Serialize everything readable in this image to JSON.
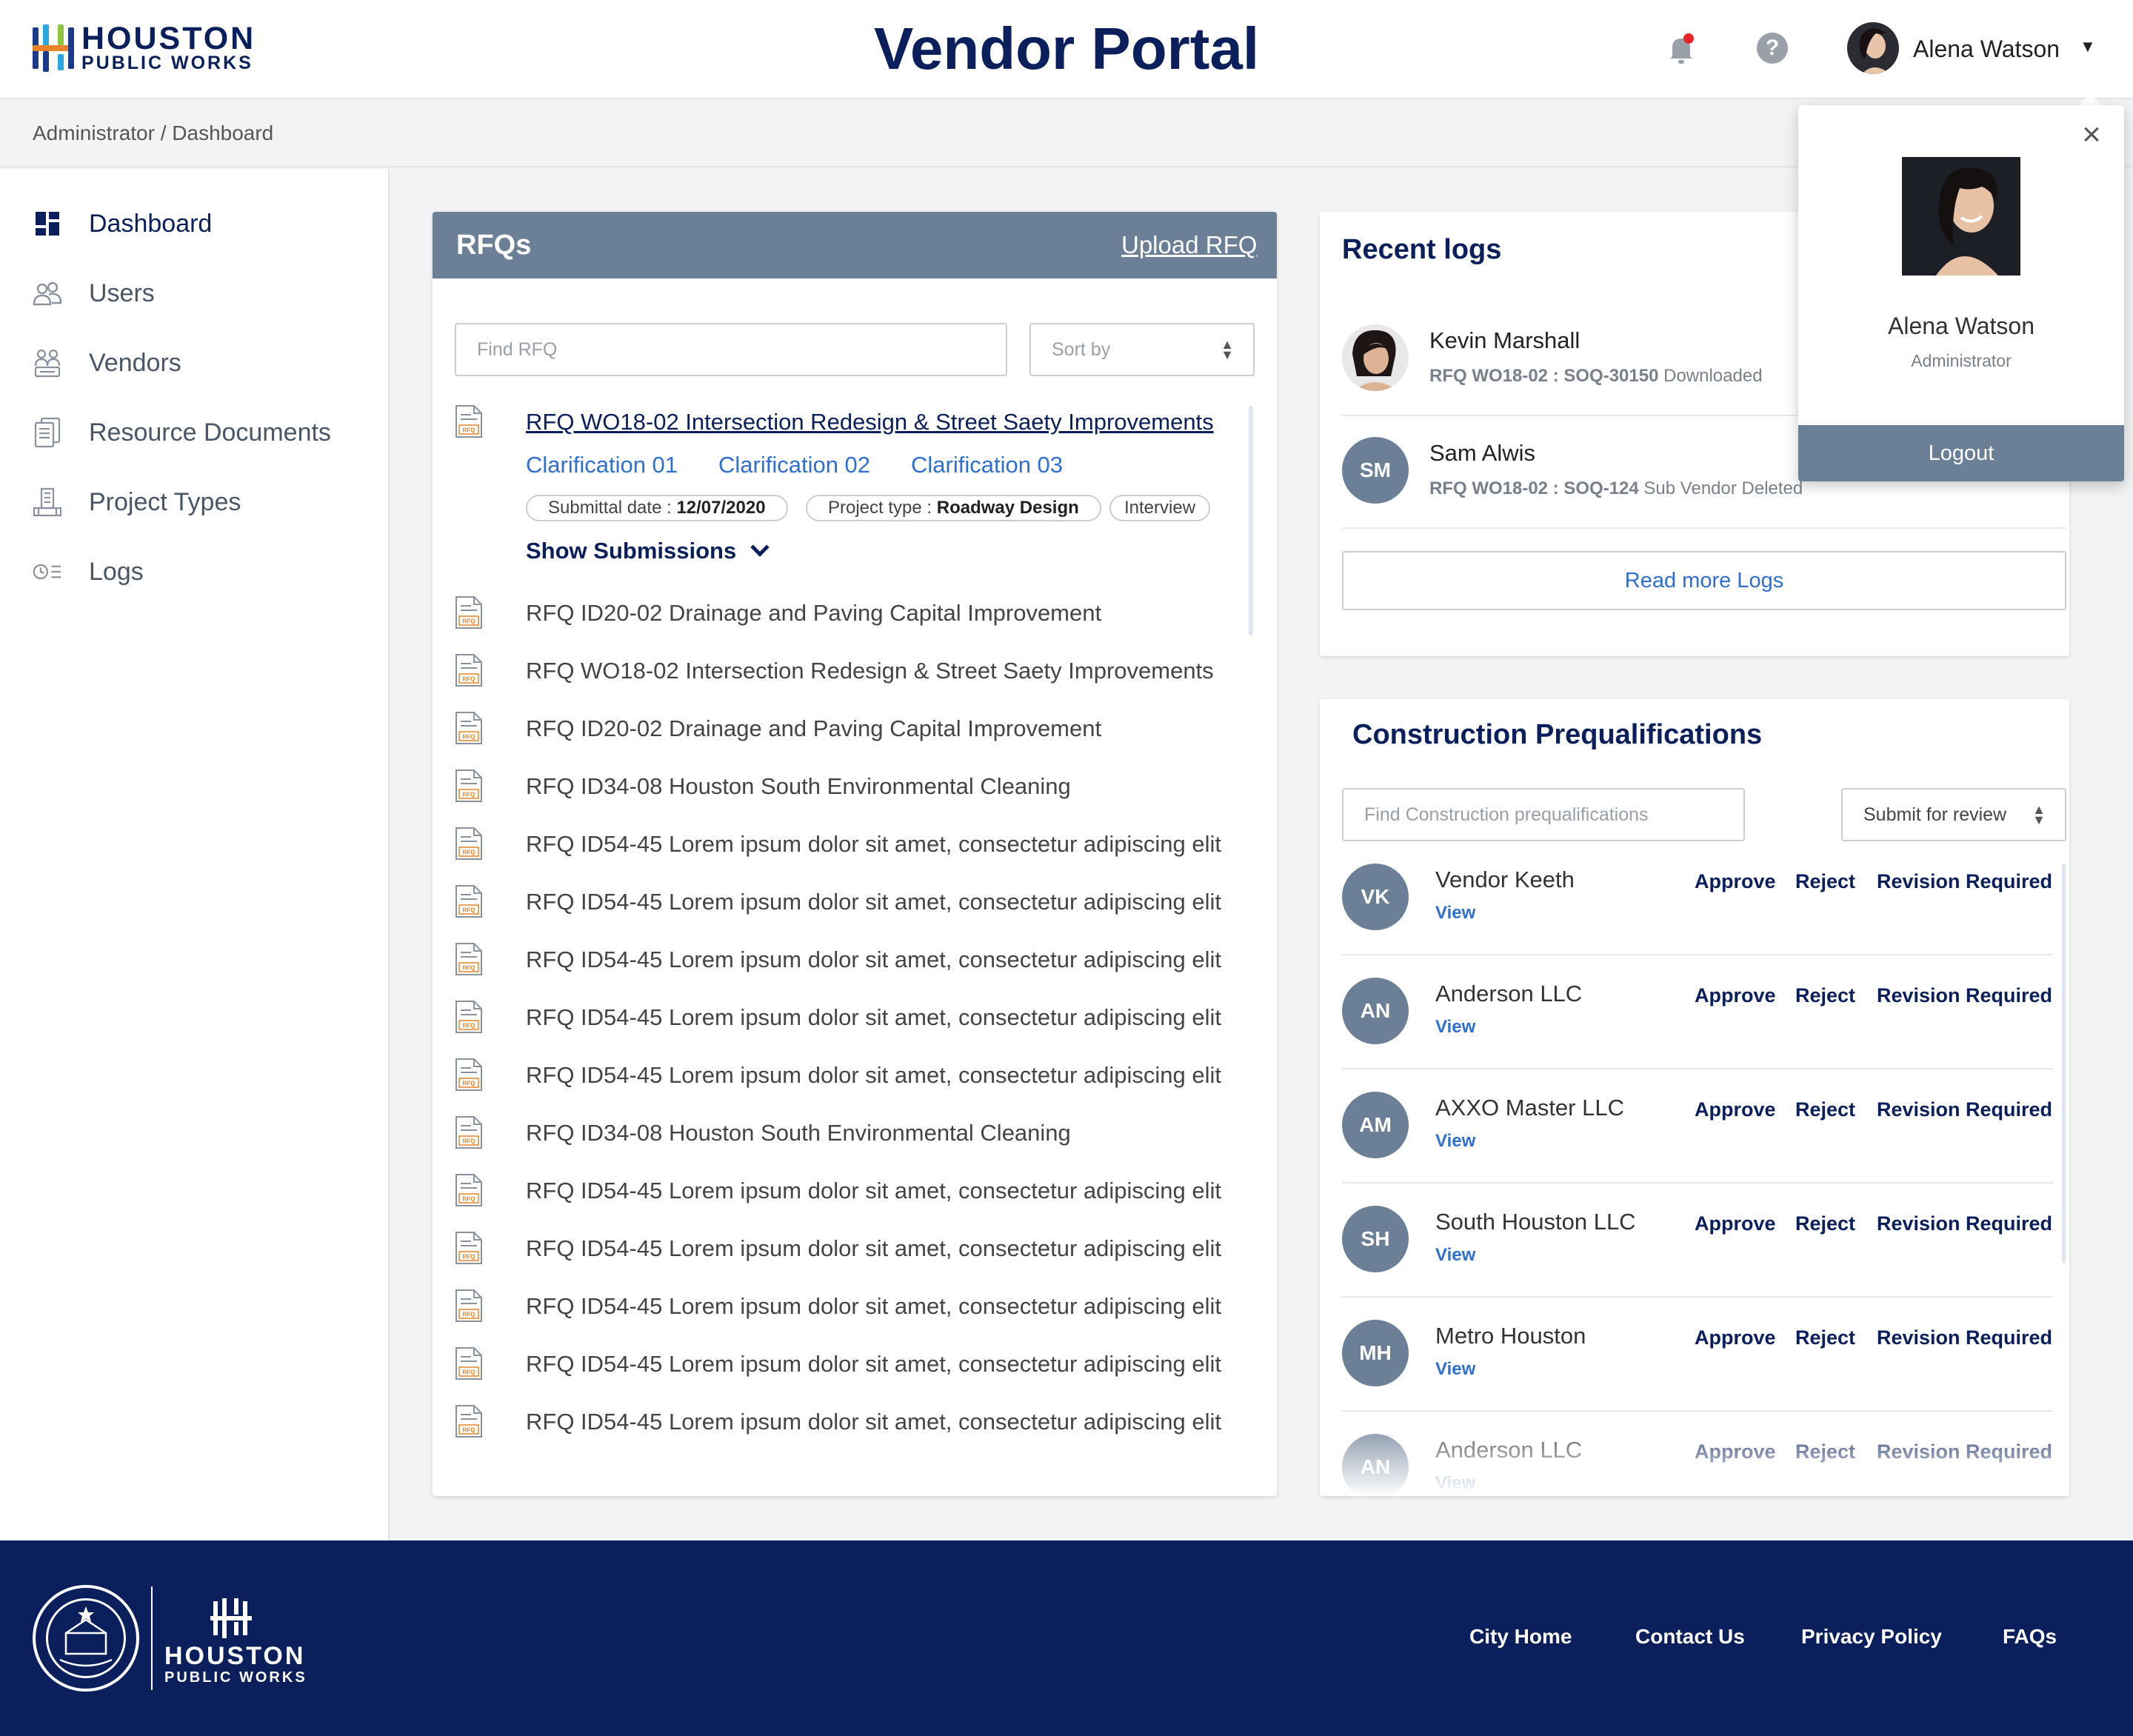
{
  "header": {
    "logo_line1": "HOUSTON",
    "logo_line2": "PUBLIC WORKS",
    "title": "Vendor Portal",
    "user_name": "Alena Watson",
    "icons": [
      "bell-icon",
      "help-icon",
      "chevron-down-icon"
    ],
    "notification_dot_color": "#e8232a"
  },
  "breadcrumb": "Administrator / Dashboard",
  "sidebar": {
    "items": [
      {
        "label": "Dashboard",
        "icon": "dashboard-icon",
        "active": true
      },
      {
        "label": "Users",
        "icon": "users-icon"
      },
      {
        "label": "Vendors",
        "icon": "vendors-icon"
      },
      {
        "label": "Resource Documents",
        "icon": "documents-icon"
      },
      {
        "label": "Project Types",
        "icon": "project-types-icon"
      },
      {
        "label": "Logs",
        "icon": "logs-icon"
      }
    ]
  },
  "rfq": {
    "title": "RFQs",
    "upload_label": "Upload RFQ",
    "search_placeholder": "Find RFQ",
    "sort_placeholder": "Sort by",
    "expanded": {
      "title": "RFQ WO18-02 Intersection Redesign & Street Saety Improvements",
      "clarifications": [
        "Clarification 01",
        "Clarification 02",
        "Clarification 03"
      ],
      "submittal_label": "Submittal date :",
      "submittal_value": "12/07/2020",
      "project_type_label": "Project  type :",
      "project_type_value": "Roadway Design",
      "tag": "Interview",
      "show_submissions": "Show Submissions"
    },
    "items": [
      "RFQ ID20-02 Drainage and Paving Capital Improvement",
      "RFQ WO18-02 Intersection Redesign & Street Saety Improvements",
      "RFQ ID20-02 Drainage and Paving Capital Improvement",
      "RFQ ID34-08 Houston South Environmental Cleaning",
      "RFQ ID54-45 Lorem ipsum dolor sit amet, consectetur adipiscing elit",
      "RFQ ID54-45 Lorem ipsum dolor sit amet, consectetur adipiscing elit",
      "RFQ ID54-45 Lorem ipsum dolor sit amet, consectetur adipiscing elit",
      "RFQ ID54-45 Lorem ipsum dolor sit amet, consectetur adipiscing elit",
      "RFQ ID54-45 Lorem ipsum dolor sit amet, consectetur adipiscing elit",
      "RFQ ID34-08 Houston South Environmental Cleaning",
      "RFQ ID54-45 Lorem ipsum dolor sit amet, consectetur adipiscing elit",
      "RFQ ID54-45 Lorem ipsum dolor sit amet, consectetur adipiscing elit",
      "RFQ ID54-45 Lorem ipsum dolor sit amet, consectetur adipiscing elit",
      "RFQ ID54-45 Lorem ipsum dolor sit amet, consectetur adipiscing elit",
      "RFQ ID54-45 Lorem ipsum dolor sit amet, consectetur adipiscing elit"
    ],
    "doc_icon_label": "RFQ"
  },
  "logs": {
    "title": "Recent logs",
    "entries": [
      {
        "name": "Kevin Marshall",
        "ref": "RFQ WO18-02 : SOQ-30150",
        "action": "Downloaded",
        "avatar": "photo"
      },
      {
        "name": "Sam Alwis",
        "ref": "RFQ WO18-02 : SOQ-124",
        "action": "Sub Vendor Deleted",
        "initials": "SM"
      }
    ],
    "read_more": "Read more Logs"
  },
  "prequal": {
    "title": "Construction Prequalifications",
    "search_placeholder": "Find Construction prequalifications",
    "filter_value": "Submit for review",
    "view_label": "View",
    "actions": [
      "Approve",
      "Reject",
      "Revision Required"
    ],
    "vendors": [
      {
        "initials": "VK",
        "name": "Vendor Keeth"
      },
      {
        "initials": "AN",
        "name": "Anderson LLC"
      },
      {
        "initials": "AM",
        "name": "AXXO Master LLC"
      },
      {
        "initials": "SH",
        "name": "South Houston LLC"
      },
      {
        "initials": "MH",
        "name": "Metro Houston"
      },
      {
        "initials": "AN",
        "name": "Anderson LLC"
      }
    ]
  },
  "popup": {
    "name": "Alena Watson",
    "role": "Administrator",
    "logout": "Logout"
  },
  "footer": {
    "logo_line1": "HOUSTON",
    "logo_line2": "PUBLIC WORKS",
    "links": [
      "City Home",
      "Contact Us",
      "Privacy Policy",
      "FAQs"
    ]
  },
  "colors": {
    "navy": "#0a1f5c",
    "slate": "#6b7f96",
    "link_blue": "#2e6fd4",
    "doc_orange": "#e8832a"
  }
}
